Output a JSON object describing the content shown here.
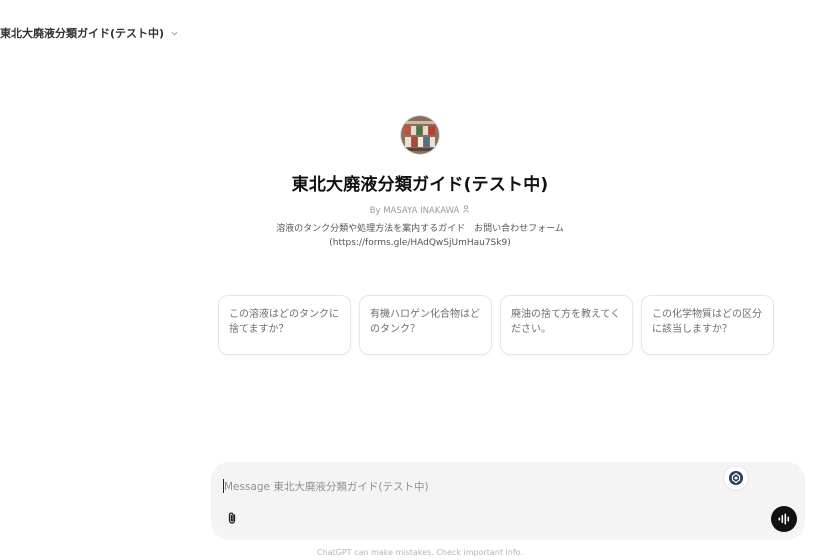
{
  "header": {
    "model_selector_label": "東北大廃液分類ガイド(テスト中)",
    "chevron_icon": "chevron-down-icon"
  },
  "gpt": {
    "avatar_icon": "gpt-avatar-icon",
    "title": "東北大廃液分類ガイド(テスト中)",
    "byline": "By MASAYA INAKAWA",
    "byline_icon": "person-icon",
    "description_line1": "溶液のタンク分類や処理方法を案内するガイド　お問い合わせフォーム",
    "description_line2": "(https://forms.gle/HAdQwSjUmHau7Sk9)"
  },
  "starters": [
    {
      "label": "この溶液はどのタンクに捨てますか？"
    },
    {
      "label": "有機ハロゲン化合物はどのタンク？"
    },
    {
      "label": "廃油の捨て方を教えてください。"
    },
    {
      "label": "この化学物質はどの区分に該当しますか？"
    }
  ],
  "composer": {
    "placeholder": "Message 東北大廃液分類ガイド(テスト中)",
    "value": "",
    "gpt_badge_icon": "gpt-logo-icon",
    "attach_icon": "paperclip-icon",
    "voice_icon": "voice-mode-icon"
  },
  "footer": {
    "note": "ChatGPT can make mistakes. Check important info."
  },
  "colors": {
    "composer_bg": "#f4f4f4",
    "voice_button_bg": "#111111",
    "starter_border": "#e5e5e5"
  }
}
